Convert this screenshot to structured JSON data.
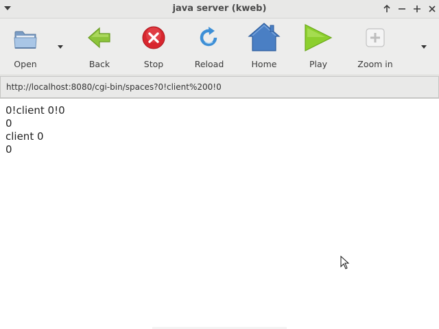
{
  "window": {
    "title": "java server (kweb)"
  },
  "toolbar": {
    "open_label": "Open",
    "back_label": "Back",
    "stop_label": "Stop",
    "reload_label": "Reload",
    "home_label": "Home",
    "play_label": "Play",
    "zoom_in_label": "Zoom in"
  },
  "icons": {
    "open": "folder-icon",
    "back": "arrow-left-icon",
    "stop": "stop-icon",
    "reload": "reload-icon",
    "home": "home-icon",
    "play": "play-icon",
    "zoom_in": "zoom-in-icon"
  },
  "address": {
    "url": "http://localhost:8080/cgi-bin/spaces?0!client%200!0"
  },
  "content": {
    "lines": [
      "0!client 0!0",
      "0",
      "client 0",
      "0"
    ]
  },
  "colors": {
    "back_arrow": "#8cc43a",
    "stop_red": "#d8262e",
    "reload_blue": "#3d8fd6",
    "home_blue": "#4a7fc4",
    "play_green": "#8ccf2e"
  }
}
